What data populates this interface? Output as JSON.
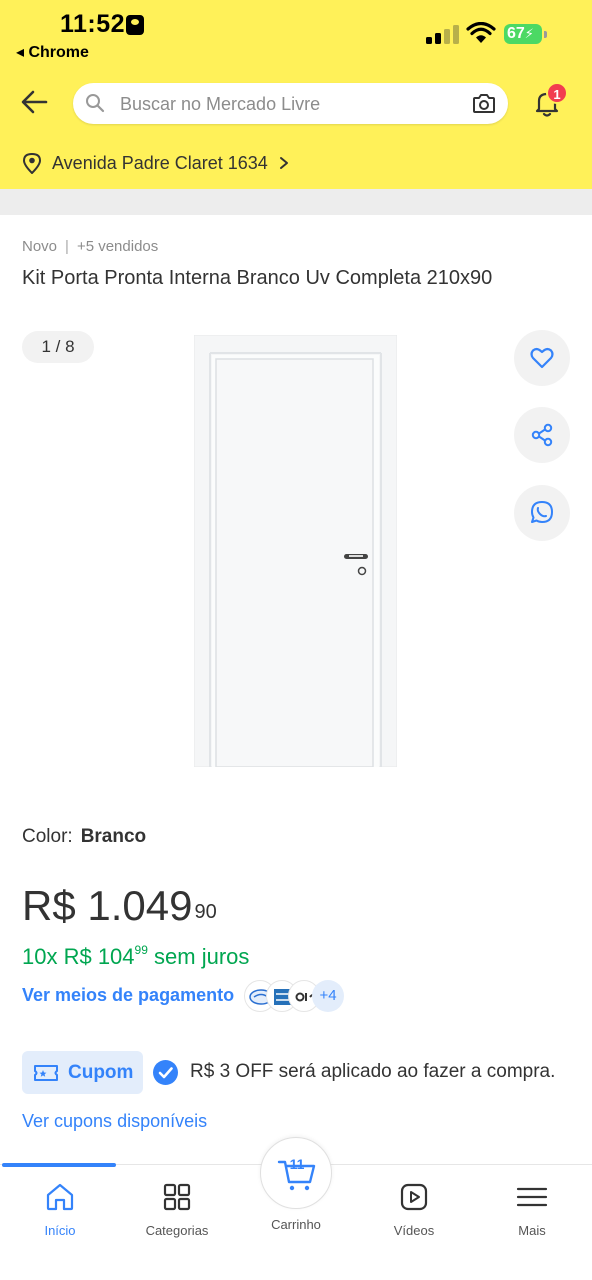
{
  "status_bar": {
    "time": "11:52",
    "back_app": "◂ Chrome",
    "battery": "67"
  },
  "header": {
    "search_placeholder": "Buscar no Mercado Livre",
    "notifications_count": "1",
    "address": "Avenida Padre Claret 1634"
  },
  "product": {
    "condition": "Novo",
    "sold": "+5 vendidos",
    "title": "Kit Porta Pronta Interna Branco Uv Completa 210x90",
    "image_counter": "1 / 8",
    "color_label": "Color:",
    "color_value": "Branco",
    "price_main": "R$ 1.049",
    "price_cents": "90",
    "installments_prefix": "10x R$ 104",
    "installments_cents": "99",
    "installments_suffix": "sem juros",
    "payment_link": "Ver meios de pagamento",
    "payment_more": "+4",
    "coupon_label": "Cupom",
    "coupon_text": "R$ 3 OFF será aplicado ao fazer a compra.",
    "coupons_link": "Ver cupons disponíveis"
  },
  "bottom_nav": {
    "items": [
      {
        "label": "Início",
        "icon": "home-icon"
      },
      {
        "label": "Categorias",
        "icon": "grid-icon"
      },
      {
        "label": "Carrinho",
        "icon": "cart-icon"
      },
      {
        "label": "Vídeos",
        "icon": "video-icon"
      },
      {
        "label": "Mais",
        "icon": "menu-icon"
      }
    ],
    "cart_count": "11"
  },
  "colors": {
    "brand_yellow": "#fff159",
    "accent_blue": "#3483fa",
    "success_green": "#00a650",
    "badge_red": "#f23d4f"
  }
}
